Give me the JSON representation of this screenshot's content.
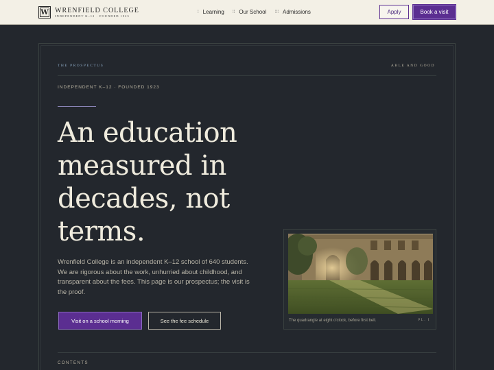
{
  "header": {
    "logo_letter": "W",
    "brand_name": "WRENFIELD COLLEGE",
    "brand_sub": "INDEPENDENT K–12 · FOUNDED 1923",
    "nav": [
      {
        "label": "Learning"
      },
      {
        "label": "Our School"
      },
      {
        "label": "Admissions"
      }
    ],
    "apply_label": "Apply",
    "book_label": "Book a visit"
  },
  "hero": {
    "section_label": "THE PROSPECTUS",
    "motto": "ABLE AND GOOD",
    "eyebrow": "INDEPENDENT K–12 · FOUNDED 1923",
    "headline": "An education measured in decades, not terms.",
    "lede": "Wrenfield College is an independent K–12 school of 640 students. We are rigorous about the work, unhurried about childhood, and transparent about the fees. This page is our prospectus; the visit is the proof.",
    "primary_cta": "Visit on a school morning",
    "secondary_cta": "See the fee schedule"
  },
  "figure": {
    "caption": "The quadrangle at eight o'clock, before first bell.",
    "plate": "PL. I"
  },
  "contents": {
    "label": "CONTENTS"
  },
  "colors": {
    "accent": "#5b2e91",
    "background": "#23272d",
    "topbar": "#f3f0e6"
  }
}
